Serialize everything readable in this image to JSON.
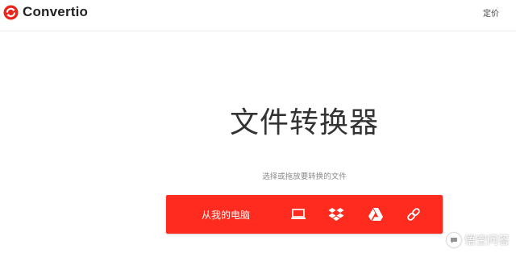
{
  "brand": {
    "name": "Convertio",
    "color": "#e8261b"
  },
  "header": {
    "pricing_label": "定价"
  },
  "hero": {
    "title": "文件转换器",
    "subtitle": "选择或拖放要转换的文件"
  },
  "upload": {
    "label": "从我的电脑",
    "bar_color": "#ff2b1f",
    "sources": [
      {
        "icon": "laptop-icon"
      },
      {
        "icon": "dropbox-icon"
      },
      {
        "icon": "google-drive-icon"
      },
      {
        "icon": "link-icon"
      }
    ]
  },
  "watermark": {
    "text": "悟空问答"
  }
}
